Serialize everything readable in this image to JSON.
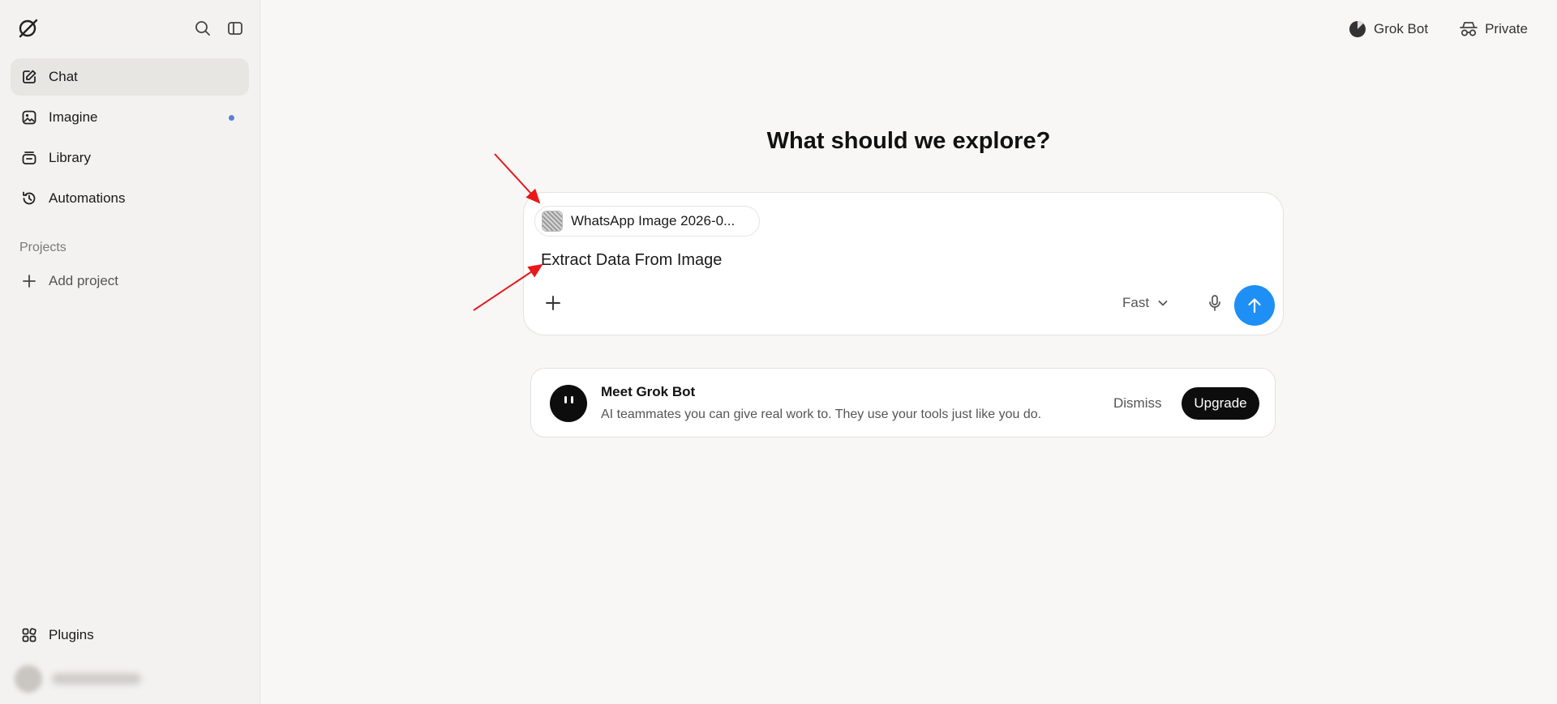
{
  "sidebar": {
    "items": [
      {
        "label": "Chat",
        "icon": "edit-icon",
        "active": true
      },
      {
        "label": "Imagine",
        "icon": "image-icon",
        "badge_dot": true
      },
      {
        "label": "Library",
        "icon": "library-icon"
      },
      {
        "label": "Automations",
        "icon": "history-clock-icon"
      }
    ],
    "projects_title": "Projects",
    "add_project_label": "Add project",
    "plugins_label": "Plugins"
  },
  "header": {
    "grok_bot_label": "Grok Bot",
    "private_label": "Private"
  },
  "main": {
    "heading": "What should we explore?"
  },
  "composer": {
    "attachment_name": "WhatsApp Image 2026-0...",
    "prompt_value": "Extract Data From Image",
    "mode_label": "Fast"
  },
  "promo": {
    "title": "Meet Grok Bot",
    "description": "AI teammates you can give real work to. They use your tools just like you do.",
    "dismiss_label": "Dismiss",
    "upgrade_label": "Upgrade"
  },
  "colors": {
    "accent_send": "#1d8ff5",
    "annotation_arrow": "#e8191c",
    "badge_dot": "#5b7fe0"
  }
}
